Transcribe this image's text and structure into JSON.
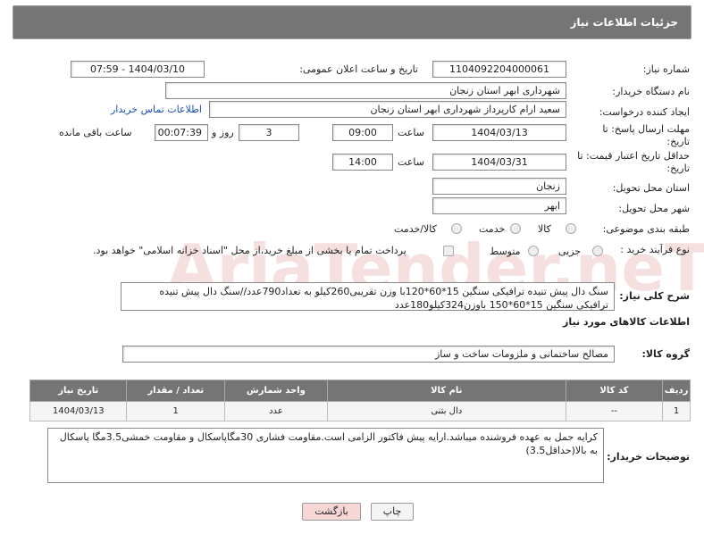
{
  "header": {
    "title": "جزئیات اطلاعات نیاز"
  },
  "fields": {
    "need_number_label": "شماره نیاز:",
    "need_number": "1104092204000061",
    "announce_label": "تاریخ و ساعت اعلان عمومی:",
    "announce_value": "1404/03/10 - 07:59",
    "buyer_org_label": "نام دستگاه خریدار:",
    "buyer_org": "شهرداری ابهر استان زنجان",
    "creator_label": "ایجاد کننده درخواست:",
    "creator": "سعید ارام کارپرداز  شهرداری ابهر استان زنجان",
    "contact_link": "اطلاعات تماس خریدار",
    "reply_deadline_label": "مهلت ارسال پاسخ: تا تاریخ:",
    "reply_date": "1404/03/13",
    "time_label": "ساعت",
    "reply_time": "09:00",
    "days_value": "3",
    "days_label": "روز و",
    "remaining_value": "00:07:39",
    "remaining_label": "ساعت باقی مانده",
    "price_deadline_label": "حداقل تاریخ اعتبار قیمت: تا تاریخ:",
    "price_date": "1404/03/31",
    "price_time_label": "ساعت",
    "price_time": "14:00",
    "province_label": "استان محل تحویل:",
    "province": "زنجان",
    "city_label": "شهر محل تحویل:",
    "city": "ابهر",
    "category_label": "طبقه بندی موضوعی:",
    "category_options": [
      "کالا",
      "خدمت",
      "کالا/خدمت"
    ],
    "process_label": "نوع فرآیند خرید :",
    "process_options": [
      "جزیی",
      "متوسط"
    ],
    "payment_note": "پرداخت تمام یا بخشی از مبلغ خرید،از محل \"اسناد خزانه اسلامی\" خواهد بود."
  },
  "description": {
    "label": "شرح کلی نیاز:",
    "text": "سنگ دال پیش تنیده ترافیکی سنگین 15*60*120با وزن تقریبی260کیلو به تعداد790عدد//سنگ دال پیش تنیده ترافیکی سنگین 15*60*150 باوزن324کیلو180عدد"
  },
  "goods_info_title": "اطلاعات کالاهای مورد نیاز",
  "goods_group": {
    "label": "گروه کالا:",
    "value": "مصالح ساختمانی و ملزومات ساخت و ساز"
  },
  "table": {
    "headers": [
      "ردیف",
      "کد کالا",
      "نام کالا",
      "واحد شمارش",
      "تعداد / مقدار",
      "تاریخ نیاز"
    ],
    "rows": [
      [
        "1",
        "--",
        "دال بتنی",
        "عدد",
        "1",
        "1404/03/13"
      ]
    ]
  },
  "buyer_notes": {
    "label": "توضیحات خریدار:",
    "text": "کرایه حمل به عهده فروشنده میباشد.ارایه پیش فاکتور الزامی است.مقاومت فشاری 30مگاپاسکال و مقاومت خمشی3.5مگا پاسکال به بالا(حداقل3.5)"
  },
  "buttons": {
    "print": "چاپ",
    "back": "بازگشت"
  },
  "watermark_text": "AriaTender.neT",
  "colors": {
    "header_bg": "#757575",
    "link": "#1a4fb3",
    "back_btn_bg": "#f7d6d6"
  }
}
